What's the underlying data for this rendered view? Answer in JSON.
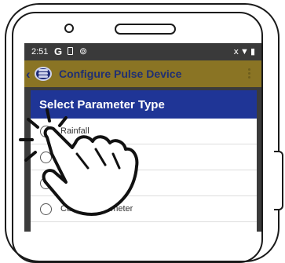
{
  "status_bar": {
    "time": "2:51",
    "indicators": [
      "G",
      "sim-card-icon",
      "sync-icon"
    ],
    "right_icons": [
      "mute-icon",
      "wifi-icon",
      "battery-icon"
    ]
  },
  "app_bar": {
    "title": "Configure Pulse Device",
    "back_icon": "chevron-left-icon",
    "logo_icon": "app-logo-icon",
    "menu_icon": "overflow-menu-icon"
  },
  "dialog": {
    "title": "Select Parameter Type",
    "options": [
      {
        "label": "Rainfall",
        "selected": false
      },
      {
        "label": "",
        "selected": false
      },
      {
        "label": "",
        "selected": false
      },
      {
        "label": "Custom Parameter",
        "selected": false
      }
    ]
  },
  "colors": {
    "app_bar": "#8a7424",
    "dialog_header": "#1f3596",
    "title_text": "#1f2f73",
    "status_bar": "#3a3a3a"
  },
  "overlay": {
    "icon": "tap-hand-icon"
  }
}
